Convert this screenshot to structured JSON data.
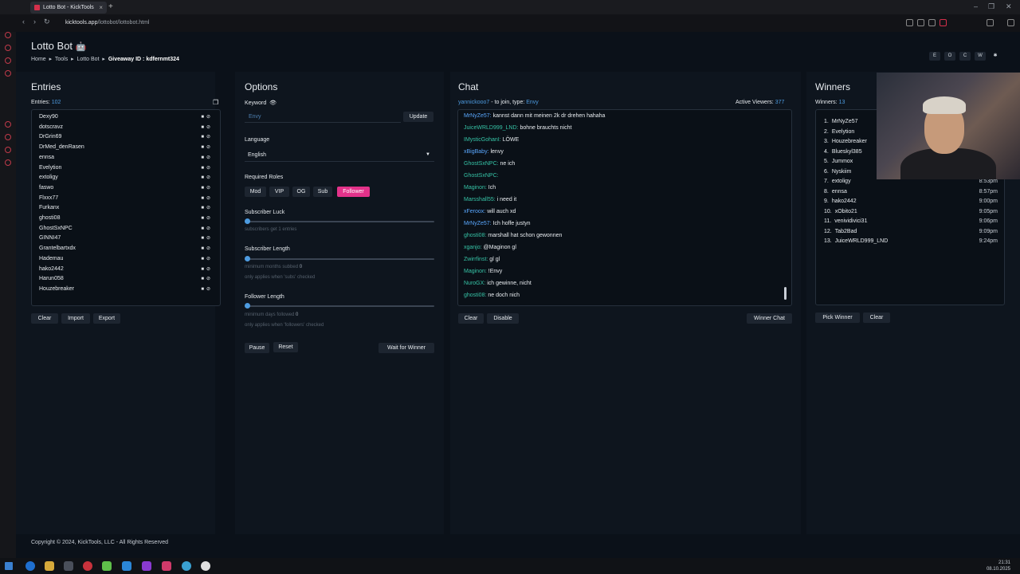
{
  "browser": {
    "tab_title": "Lotto Bot - KickTools",
    "url_domain": "kicktools.app",
    "url_path": "/lottobot/lottobot.html"
  },
  "page": {
    "title": "Lotto Bot",
    "breadcrumb": [
      "Home",
      "Tools",
      "Lotto Bot"
    ],
    "giveaway_label": "Giveaway ID :",
    "giveaway_id": "kdfernmt324",
    "top_buttons": [
      "E",
      "O",
      "C",
      "W"
    ]
  },
  "entries": {
    "header": "Entries",
    "count_label": "Entries:",
    "count": "102",
    "items": [
      "Dexy90",
      "dotscravz",
      "DrGrin69",
      "DrMed_denRasen",
      "ennsa",
      "Evelytion",
      "extoligy",
      "faswo",
      "Flxxx77",
      "Furkanx",
      "ghosti08",
      "GhostSxNPC",
      "GINNI47",
      "Grantelbartxdx",
      "Hademau",
      "hako2442",
      "Harun058",
      "Houzebreaker"
    ],
    "buttons": [
      "Clear",
      "Import",
      "Export"
    ]
  },
  "options": {
    "header": "Options",
    "keyword_label": "Keyword",
    "keyword_value": "Envy",
    "update_button": "Update",
    "language_label": "Language",
    "language_value": "English",
    "roles_label": "Required Roles",
    "roles": [
      "Mod",
      "VIP",
      "OG",
      "Sub",
      "Follower"
    ],
    "active_role": "Follower",
    "subscriber_luck_label": "Subscriber Luck",
    "subscriber_luck_hint": "subscribers get 1 entries",
    "subscriber_length_label": "Subscriber Length",
    "subscriber_length_hint": "minimum months subbed",
    "subscriber_length_value": "0",
    "subscriber_length_note": "only applies when 'subs' checked",
    "follower_length_label": "Follower Length",
    "follower_length_hint": "minimum days followed",
    "follower_length_value": "0",
    "follower_length_note": "only applies when 'followers' checked",
    "buttons": [
      "Pause",
      "Reset",
      "Wait for Winner"
    ]
  },
  "chat": {
    "header": "Chat",
    "join_user": "yannickooo7",
    "join_text": "- to join, type:",
    "join_keyword": "Envy",
    "viewers_label": "Active Viewers:",
    "viewers": "377",
    "messages": [
      {
        "user": "MrNyZe57:",
        "text": "kannst dann mit meinen 2k dr drehen hahaha",
        "c": "ub"
      },
      {
        "user": "JuiceWRLD999_LND:",
        "text": "bohne brauchts nicht",
        "c": "u"
      },
      {
        "user": "IMysticGohanI:",
        "text": "LÖWE",
        "c": "u"
      },
      {
        "user": "xBigBaby:",
        "text": "lenvy",
        "c": "ub"
      },
      {
        "user": "GhostSxNPC:",
        "text": "ne ich",
        "c": "u"
      },
      {
        "user": "GhostSxNPC:",
        "text": "",
        "c": "u"
      },
      {
        "user": "Maginon:",
        "text": "Ich",
        "c": "u"
      },
      {
        "user": "Marsshall55:",
        "text": "i need it",
        "c": "u"
      },
      {
        "user": "xFeroox:",
        "text": "will auch xd",
        "c": "ub"
      },
      {
        "user": "MrNyZe57:",
        "text": "Ich hoffe justyn",
        "c": "ub"
      },
      {
        "user": "ghosti08:",
        "text": "marshall hat schon gewonnen",
        "c": "u"
      },
      {
        "user": "xganjo:",
        "text": "@Maginon gl",
        "c": "u"
      },
      {
        "user": "Zwirrfinst:",
        "text": "gl gl",
        "c": "u"
      },
      {
        "user": "Maginon:",
        "text": "!Envy",
        "c": "u"
      },
      {
        "user": "NuroGX:",
        "text": "ich gewinne, nicht",
        "c": "u"
      },
      {
        "user": "ghosti08:",
        "text": "ne doch nich",
        "c": "u"
      }
    ],
    "buttons": [
      "Clear",
      "Disable",
      "Winner Chat"
    ]
  },
  "winners": {
    "header": "Winners",
    "count_label": "Winners:",
    "count": "13",
    "items": [
      {
        "n": "1.",
        "name": "MrNyZe57",
        "time": ""
      },
      {
        "n": "2.",
        "name": "Evelytion",
        "time": ""
      },
      {
        "n": "3.",
        "name": "Houzebreaker",
        "time": ""
      },
      {
        "n": "4.",
        "name": "Blueskyl385",
        "time": ""
      },
      {
        "n": "5.",
        "name": "Jummox",
        "time": ""
      },
      {
        "n": "6.",
        "name": "Nyskiim",
        "time": ""
      },
      {
        "n": "7.",
        "name": "extoligy",
        "time": "8:53pm"
      },
      {
        "n": "8.",
        "name": "ennsa",
        "time": "8:57pm"
      },
      {
        "n": "9.",
        "name": "hako2442",
        "time": "9:00pm"
      },
      {
        "n": "10.",
        "name": "xObito21",
        "time": "9:05pm"
      },
      {
        "n": "11.",
        "name": "venividivici31",
        "time": "9:06pm"
      },
      {
        "n": "12.",
        "name": "Tab2Bad",
        "time": "9:09pm"
      },
      {
        "n": "13.",
        "name": "JuiceWRLD999_LND",
        "time": "9:24pm"
      }
    ],
    "buttons": [
      "Pick Winner",
      "Clear"
    ]
  },
  "footer": "Copyright © 2024, KickTools, LLC - All Rights Reserved",
  "clock": {
    "time": "21:31",
    "date": "08.10.2025"
  }
}
